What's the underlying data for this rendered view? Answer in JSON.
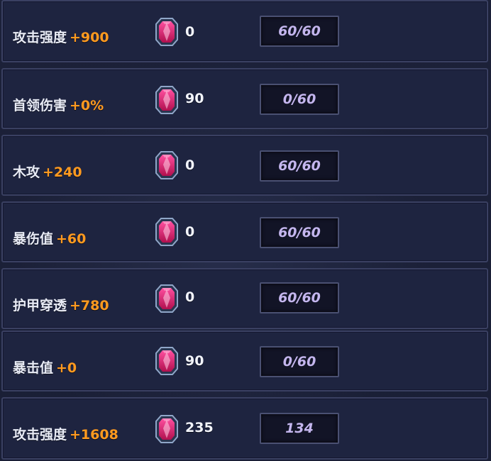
{
  "rows": [
    {
      "stat": "攻击强度",
      "bonus": "+900",
      "cost": "0",
      "progress": "60/60",
      "icon": "crystal-gem-icon"
    },
    {
      "stat": "首领伤害",
      "bonus": "+0%",
      "cost": "90",
      "progress": "0/60",
      "icon": "crystal-gem-icon"
    },
    {
      "stat": "木攻",
      "bonus": "+240",
      "cost": "0",
      "progress": "60/60",
      "icon": "crystal-gem-icon"
    },
    {
      "stat": "暴伤值",
      "bonus": "+60",
      "cost": "0",
      "progress": "60/60",
      "icon": "crystal-gem-icon"
    },
    {
      "stat": "护甲穿透",
      "bonus": "+780",
      "cost": "0",
      "progress": "60/60",
      "icon": "crystal-gem-icon"
    },
    {
      "stat": "暴击值",
      "bonus": "+0",
      "cost": "90",
      "progress": "0/60",
      "icon": "crystal-gem-icon"
    },
    {
      "stat": "攻击强度",
      "bonus": "+1608",
      "cost": "235",
      "progress": "134",
      "icon": "crystal-gem-icon"
    }
  ],
  "colors": {
    "bonus": "#ff9a1f",
    "progress": "#c4b6ee",
    "panel": "#1e2440",
    "border": "#3a4062"
  }
}
